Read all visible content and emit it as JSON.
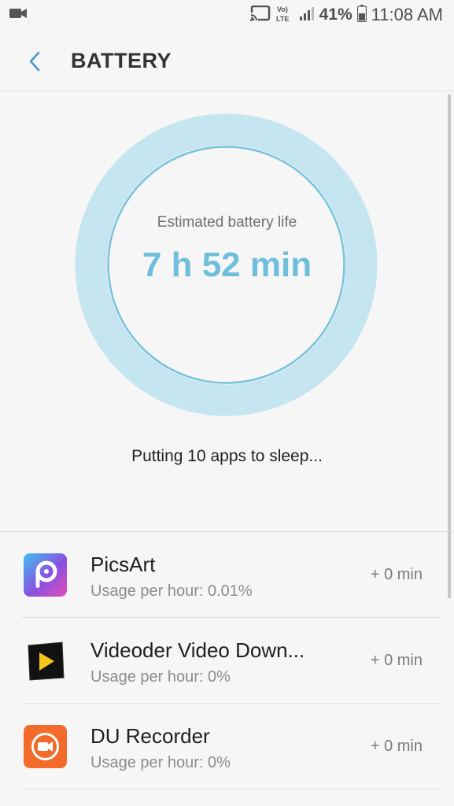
{
  "status_bar": {
    "network_label": "VoLTE",
    "battery_percent": "41%",
    "time": "11:08 AM"
  },
  "header": {
    "title": "BATTERY"
  },
  "battery": {
    "estimate_label": "Estimated battery life",
    "estimate_value": "7 h 52 min",
    "ring_color": "#c5e5f1",
    "accent_color": "#6fbfdc",
    "sleep_status": "Putting 10 apps to sleep..."
  },
  "apps": [
    {
      "name": "PicsArt",
      "usage": "Usage per hour: 0.01%",
      "time": "+ 0 min",
      "icon": "picsart-icon"
    },
    {
      "name": "Videoder Video Down...",
      "usage": "Usage per hour: 0%",
      "time": "+ 0 min",
      "icon": "videoder-icon"
    },
    {
      "name": "DU Recorder",
      "usage": "Usage per hour: 0%",
      "time": "+ 0 min",
      "icon": "du-recorder-icon"
    }
  ]
}
